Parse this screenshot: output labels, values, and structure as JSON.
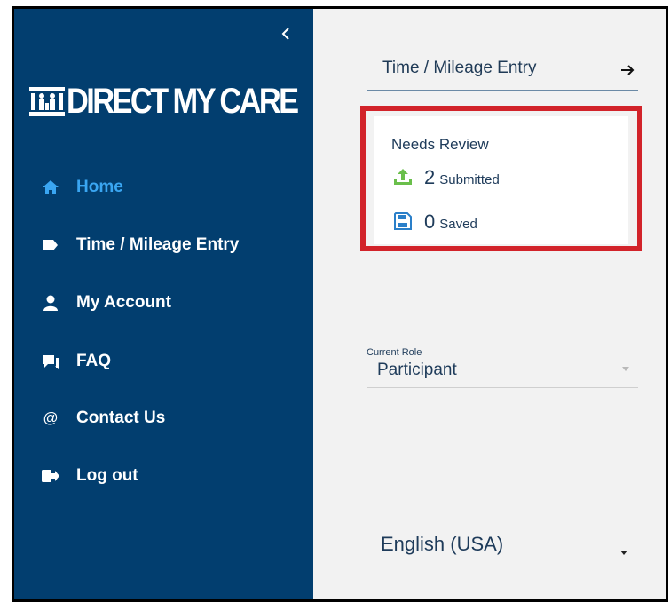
{
  "sidebar": {
    "logo_text": "DIRECT MY CARE",
    "items": [
      {
        "label": "Home",
        "icon": "home-icon",
        "active": true
      },
      {
        "label": "Time / Mileage Entry",
        "icon": "tag-icon"
      },
      {
        "label": "My Account",
        "icon": "user-icon"
      },
      {
        "label": "FAQ",
        "icon": "chat-icon"
      },
      {
        "label": "Contact Us",
        "icon": "at-icon"
      },
      {
        "label": "Log out",
        "icon": "logout-icon"
      }
    ]
  },
  "main": {
    "time_link_label": "Time / Mileage Entry",
    "review": {
      "title": "Needs Review",
      "submitted_count": "2",
      "submitted_label": "Submitted",
      "saved_count": "0",
      "saved_label": "Saved"
    },
    "role": {
      "caption": "Current Role",
      "value": "Participant"
    },
    "language": {
      "value": "English (USA)"
    }
  },
  "colors": {
    "sidebar_bg": "#023e6f",
    "active_nav": "#3aa6f2",
    "highlight_border": "#d2232a",
    "upload_icon": "#6abf4b",
    "save_icon": "#2a7fc9"
  }
}
